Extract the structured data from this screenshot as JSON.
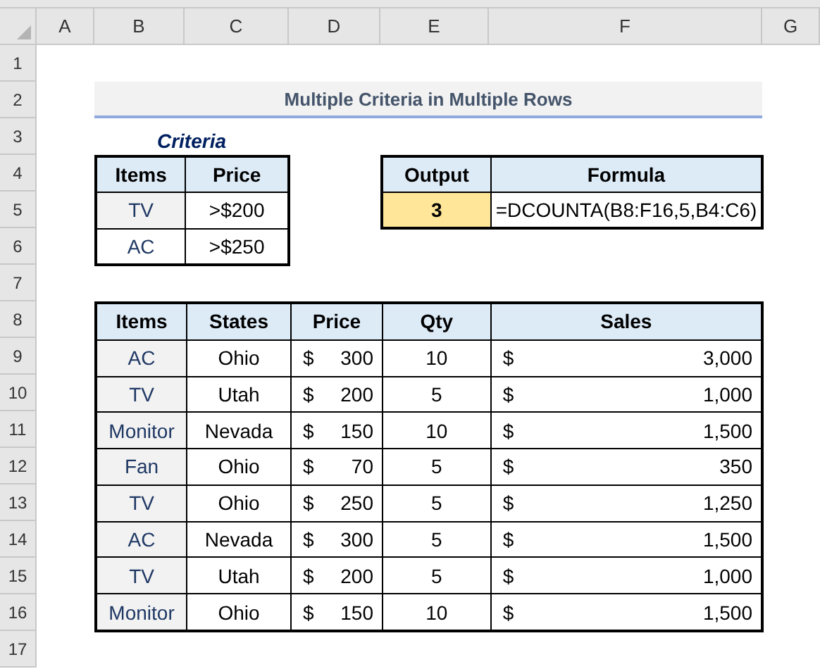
{
  "column_headers": [
    "A",
    "B",
    "C",
    "D",
    "E",
    "F",
    "G"
  ],
  "row_headers": [
    "1",
    "2",
    "3",
    "4",
    "5",
    "6",
    "7",
    "8",
    "9",
    "10",
    "11",
    "12",
    "13",
    "14",
    "15",
    "16",
    "17"
  ],
  "title": "Multiple Criteria in Multiple Rows",
  "criteria_label": "Criteria",
  "criteria_table": {
    "columns": [
      "Items",
      "Price"
    ],
    "rows": [
      {
        "item": "TV",
        "price": ">$200",
        "shaded": true
      },
      {
        "item": "AC",
        "price": ">$250",
        "shaded": false
      }
    ]
  },
  "output_table": {
    "columns": [
      "Output",
      "Formula"
    ],
    "output": "3",
    "formula": "=DCOUNTA(B8:F16,5,B4:C6)"
  },
  "data_table": {
    "columns": [
      "Items",
      "States",
      "Price",
      "Qty",
      "Sales"
    ],
    "rows": [
      {
        "item": "AC",
        "state": "Ohio",
        "price_symbol": "$",
        "price": "300",
        "qty": "10",
        "sales_symbol": "$",
        "sales": "3,000"
      },
      {
        "item": "TV",
        "state": "Utah",
        "price_symbol": "$",
        "price": "200",
        "qty": "5",
        "sales_symbol": "$",
        "sales": "1,000"
      },
      {
        "item": "Monitor",
        "state": "Nevada",
        "price_symbol": "$",
        "price": "150",
        "qty": "10",
        "sales_symbol": "$",
        "sales": "1,500"
      },
      {
        "item": "Fan",
        "state": "Ohio",
        "price_symbol": "$",
        "price": "70",
        "qty": "5",
        "sales_symbol": "$",
        "sales": "350"
      },
      {
        "item": "TV",
        "state": "Ohio",
        "price_symbol": "$",
        "price": "250",
        "qty": "5",
        "sales_symbol": "$",
        "sales": "1,250"
      },
      {
        "item": "AC",
        "state": "Nevada",
        "price_symbol": "$",
        "price": "300",
        "qty": "5",
        "sales_symbol": "$",
        "sales": "1,500"
      },
      {
        "item": "TV",
        "state": "Utah",
        "price_symbol": "$",
        "price": "200",
        "qty": "5",
        "sales_symbol": "$",
        "sales": "1,000"
      },
      {
        "item": "Monitor",
        "state": "Ohio",
        "price_symbol": "$",
        "price": "150",
        "qty": "10",
        "sales_symbol": "$",
        "sales": "1,500"
      }
    ]
  }
}
